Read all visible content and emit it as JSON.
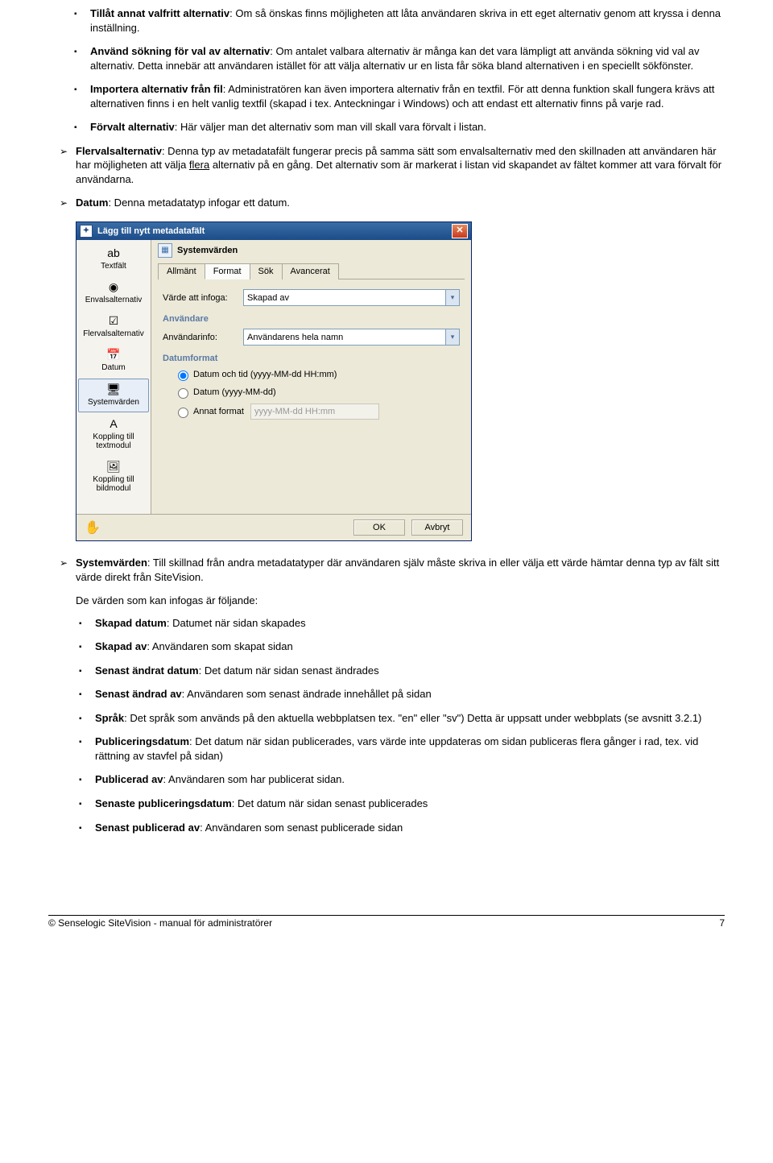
{
  "bullets_top": [
    {
      "bold": "Tillåt annat valfritt alternativ",
      "text": ": Om så önskas finns möjligheten att låta användaren skriva in ett eget alternativ genom att kryssa i denna inställning."
    },
    {
      "bold": "Använd sökning för val av alternativ",
      "text": ": Om antalet valbara alternativ är många kan det vara lämpligt att använda sökning vid val av alternativ. Detta innebär att användaren istället för att välja alternativ ur en lista får söka bland alternativen i en speciellt sökfönster."
    },
    {
      "bold": "Importera alternativ från fil",
      "text": ": Administratören kan även importera alternativ från en textfil. För att denna funktion skall fungera krävs att alternativen finns i en helt vanlig textfil (skapad i tex. Anteckningar i Windows) och att endast ett alternativ finns på varje rad."
    },
    {
      "bold": "Förvalt alternativ",
      "text": ": Här väljer man det alternativ som man vill skall vara förvalt i listan."
    }
  ],
  "arrows_top": [
    {
      "bold": "Flervalsalternativ",
      "text": ": Denna typ av metadatafält fungerar precis på samma sätt som envalsalternativ med den skillnaden att användaren här har möjligheten att välja ",
      "underline": "flera",
      "text2": " alternativ på en gång. Det alternativ som är markerat i listan vid skapandet av fältet kommer att vara förvalt för användarna."
    },
    {
      "bold": "Datum",
      "text": ": Denna metadatatyp infogar ett datum."
    }
  ],
  "dialog": {
    "title": "Lägg till nytt metadatafält",
    "heading": "Systemvärden",
    "sidebar": [
      {
        "label": "Textfält",
        "glyph": "ab"
      },
      {
        "label": "Envalsalternativ",
        "glyph": "◉"
      },
      {
        "label": "Flervalsalternativ",
        "glyph": "☑"
      },
      {
        "label": "Datum",
        "glyph": "📅"
      },
      {
        "label": "Systemvärden",
        "glyph": "🖥",
        "selected": true
      },
      {
        "label": "Koppling till textmodul",
        "glyph": "A"
      },
      {
        "label": "Koppling till bildmodul",
        "glyph": "🖼"
      }
    ],
    "tabs": [
      "Allmänt",
      "Format",
      "Sök",
      "Avancerat"
    ],
    "active_tab": "Format",
    "field_varde_label": "Värde att infoga:",
    "field_varde_value": "Skapad av",
    "section_anvandare": "Användare",
    "field_userinfo_label": "Användarinfo:",
    "field_userinfo_value": "Användarens hela namn",
    "section_datumformat": "Datumformat",
    "radio1": "Datum och tid (yyyy-MM-dd HH:mm)",
    "radio2": "Datum (yyyy-MM-dd)",
    "radio3": "Annat format",
    "radio3_placeholder": "yyyy-MM-dd HH:mm",
    "ok": "OK",
    "cancel": "Avbryt"
  },
  "arrows_bottom_intro": {
    "bold": "Systemvärden",
    "text": ": Till skillnad från andra metadatatyper där användaren själv måste skriva in eller välja ett värde hämtar denna typ av fält sitt värde direkt från SiteVision."
  },
  "values_intro": "De värden som kan infogas är följande:",
  "value_bullets": [
    {
      "bold": "Skapad datum",
      "text": ":  Datumet när sidan skapades"
    },
    {
      "bold": "Skapad av",
      "text": ":  Användaren som skapat sidan"
    },
    {
      "bold": "Senast ändrat datum",
      "text": ": Det datum när sidan senast ändrades"
    },
    {
      "bold": "Senast ändrad av",
      "text": ": Användaren som senast ändrade innehållet på sidan"
    },
    {
      "bold": "Språk",
      "text": ": Det språk som används på den aktuella webbplatsen tex. \"en\" eller \"sv\") Detta är uppsatt under webbplats (se avsnitt 3.2.1)"
    },
    {
      "bold": "Publiceringsdatum",
      "text": ": Det datum när sidan publicerades, vars värde inte uppdateras om sidan publiceras flera gånger i rad, tex. vid rättning av stavfel på sidan)"
    },
    {
      "bold": "Publicerad av",
      "text": ": Användaren som har publicerat sidan."
    },
    {
      "bold": "Senaste publiceringsdatum",
      "text": ": Det datum när sidan senast publicerades"
    },
    {
      "bold": "Senast publicerad av",
      "text": ": Användaren som senast publicerade sidan"
    }
  ],
  "footer_left": "© Senselogic SiteVision - manual för administratörer",
  "footer_right": "7"
}
